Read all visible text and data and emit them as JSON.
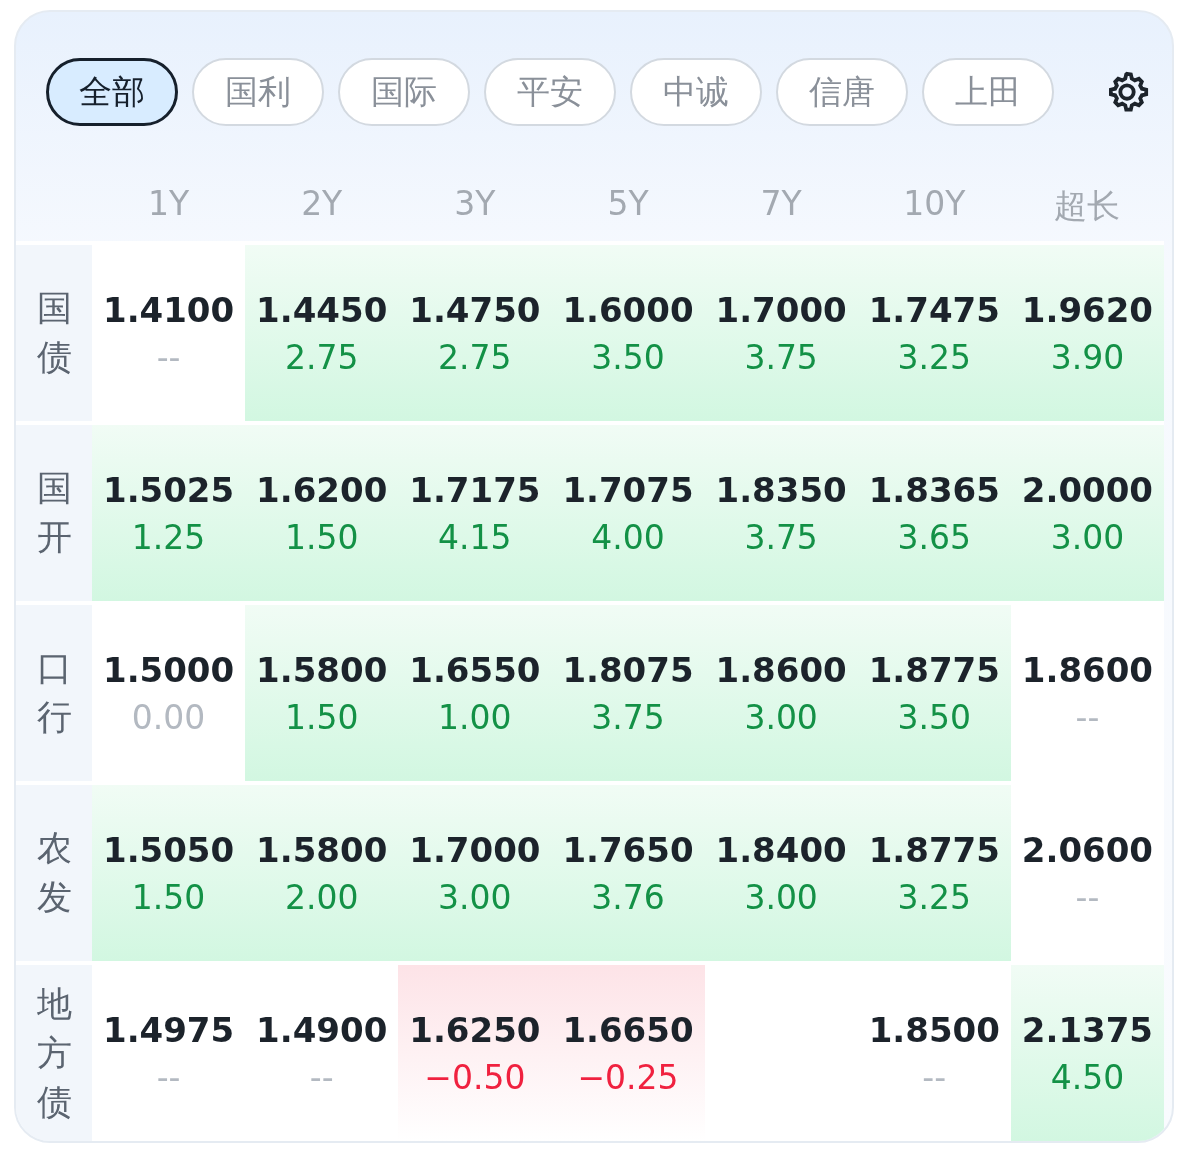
{
  "tabs": [
    {
      "label": "全部",
      "selected": true
    },
    {
      "label": "国利",
      "selected": false
    },
    {
      "label": "国际",
      "selected": false
    },
    {
      "label": "平安",
      "selected": false
    },
    {
      "label": "中诚",
      "selected": false
    },
    {
      "label": "信唐",
      "selected": false
    },
    {
      "label": "上田",
      "selected": false
    }
  ],
  "columns": [
    "1Y",
    "2Y",
    "3Y",
    "5Y",
    "7Y",
    "10Y",
    "超长"
  ],
  "rows": [
    {
      "label": "国债",
      "cells": [
        {
          "rate": "1.4100",
          "change": "--",
          "kind": "flat"
        },
        {
          "rate": "1.4450",
          "change": "2.75",
          "kind": "up"
        },
        {
          "rate": "1.4750",
          "change": "2.75",
          "kind": "up"
        },
        {
          "rate": "1.6000",
          "change": "3.50",
          "kind": "up"
        },
        {
          "rate": "1.7000",
          "change": "3.75",
          "kind": "up"
        },
        {
          "rate": "1.7475",
          "change": "3.25",
          "kind": "up"
        },
        {
          "rate": "1.9620",
          "change": "3.90",
          "kind": "up"
        }
      ]
    },
    {
      "label": "国开",
      "cells": [
        {
          "rate": "1.5025",
          "change": "1.25",
          "kind": "up"
        },
        {
          "rate": "1.6200",
          "change": "1.50",
          "kind": "up"
        },
        {
          "rate": "1.7175",
          "change": "4.15",
          "kind": "up"
        },
        {
          "rate": "1.7075",
          "change": "4.00",
          "kind": "up"
        },
        {
          "rate": "1.8350",
          "change": "3.75",
          "kind": "up"
        },
        {
          "rate": "1.8365",
          "change": "3.65",
          "kind": "up"
        },
        {
          "rate": "2.0000",
          "change": "3.00",
          "kind": "up"
        }
      ]
    },
    {
      "label": "口行",
      "cells": [
        {
          "rate": "1.5000",
          "change": "0.00",
          "kind": "flat"
        },
        {
          "rate": "1.5800",
          "change": "1.50",
          "kind": "up"
        },
        {
          "rate": "1.6550",
          "change": "1.00",
          "kind": "up"
        },
        {
          "rate": "1.8075",
          "change": "3.75",
          "kind": "up"
        },
        {
          "rate": "1.8600",
          "change": "3.00",
          "kind": "up"
        },
        {
          "rate": "1.8775",
          "change": "3.50",
          "kind": "up"
        },
        {
          "rate": "1.8600",
          "change": "--",
          "kind": "flat"
        }
      ]
    },
    {
      "label": "农发",
      "cells": [
        {
          "rate": "1.5050",
          "change": "1.50",
          "kind": "up"
        },
        {
          "rate": "1.5800",
          "change": "2.00",
          "kind": "up"
        },
        {
          "rate": "1.7000",
          "change": "3.00",
          "kind": "up"
        },
        {
          "rate": "1.7650",
          "change": "3.76",
          "kind": "up"
        },
        {
          "rate": "1.8400",
          "change": "3.00",
          "kind": "up"
        },
        {
          "rate": "1.8775",
          "change": "3.25",
          "kind": "up"
        },
        {
          "rate": "2.0600",
          "change": "--",
          "kind": "flat"
        }
      ]
    },
    {
      "label": "地方债",
      "cells": [
        {
          "rate": "1.4975",
          "change": "--",
          "kind": "flat"
        },
        {
          "rate": "1.4900",
          "change": "--",
          "kind": "flat"
        },
        {
          "rate": "1.6250",
          "change": "−0.50",
          "kind": "down"
        },
        {
          "rate": "1.6650",
          "change": "−0.25",
          "kind": "down"
        },
        {
          "kind": "empty"
        },
        {
          "rate": "1.8500",
          "change": "--",
          "kind": "flat"
        },
        {
          "rate": "2.1375",
          "change": "4.50",
          "kind": "up"
        }
      ]
    }
  ]
}
